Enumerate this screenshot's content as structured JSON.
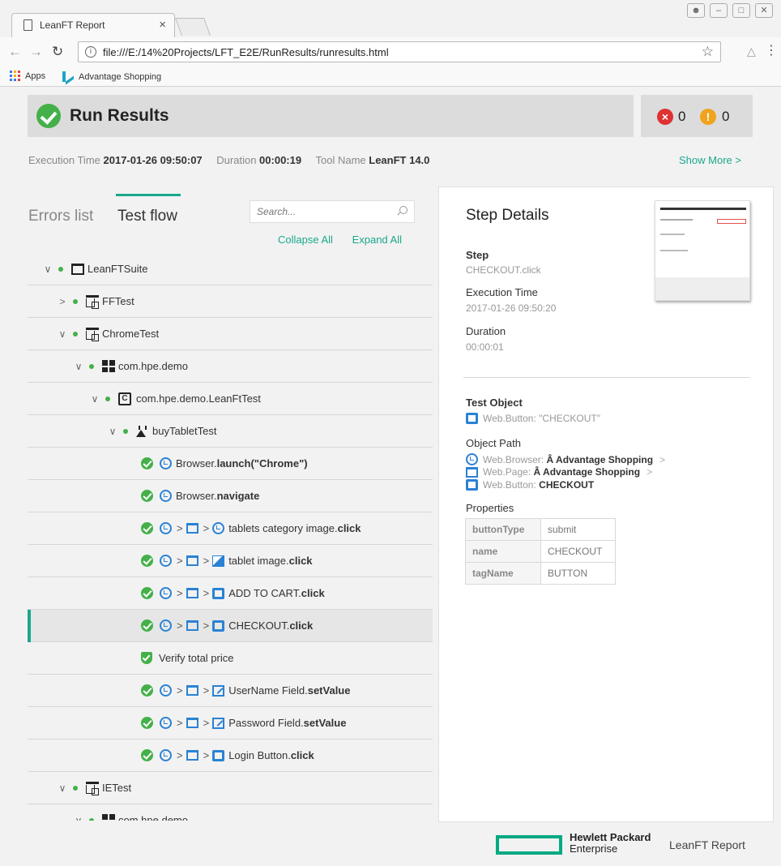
{
  "browser": {
    "tab_title": "LeanFT Report",
    "tab_close": "×",
    "url": "file:///E:/14%20Projects/LFT_E2E/RunResults/runresults.html",
    "bookmarks": [
      "Apps",
      "Advantage Shopping"
    ]
  },
  "header": {
    "title": "Run Results",
    "error_count": "0",
    "warning_count": "0"
  },
  "meta": {
    "execution_time_label": "Execution Time",
    "execution_time": "2017-01-26 09:50:07",
    "duration_label": "Duration",
    "duration": "00:00:19",
    "tool_name_label": "Tool Name",
    "tool_name": "LeanFT 14.0",
    "show_more": "Show More >"
  },
  "panel": {
    "tab_errors": "Errors list",
    "tab_flow": "Test flow",
    "search_placeholder": "Search...",
    "collapse_all": "Collapse All",
    "expand_all": "Expand All"
  },
  "tree": {
    "suite": "LeanFTSuite",
    "ff_test": "FFTest",
    "chrome_test": "ChromeTest",
    "package": "com.hpe.demo",
    "class": "com.hpe.demo.LeanFtTest",
    "method": "buyTabletTest",
    "step1": "Browser.",
    "step1_b": "launch(\"Chrome\")",
    "step2": "Browser.",
    "step2_b": "navigate",
    "step3": "tablets category image.",
    "step3_b": "click",
    "step4": "tablet image.",
    "step4_b": "click",
    "step5": "ADD TO CART.",
    "step5_b": "click",
    "step6": "CHECKOUT.",
    "step6_b": "click",
    "step7": "Verify total price",
    "step8": "UserName Field.",
    "step8_b": "setValue",
    "step9": "Password Field.",
    "step9_b": "setValue",
    "step10": "Login Button.",
    "step10_b": "click",
    "ie_test": "IETest",
    "ie_package": "com.hpe.demo"
  },
  "details": {
    "title": "Step Details",
    "step_label": "Step",
    "step_value": "CHECKOUT.click",
    "exec_label": "Execution Time",
    "exec_value": "2017-01-26 09:50:20",
    "duration_label": "Duration",
    "duration_value": "00:00:01",
    "test_object_label": "Test Object",
    "test_object_value": "Web.Button: \"CHECKOUT\"",
    "object_path_label": "Object Path",
    "path_browser_prefix": "Web.Browser:",
    "path_browser_name": "Â Advantage Shopping",
    "path_page_prefix": "Web.Page:",
    "path_page_name": "Â Advantage Shopping",
    "path_button_prefix": "Web.Button:",
    "path_button_name": "CHECKOUT",
    "path_sep": ">",
    "properties_label": "Properties",
    "properties": [
      {
        "key": "buttonType",
        "value": "submit"
      },
      {
        "key": "name",
        "value": "CHECKOUT"
      },
      {
        "key": "tagName",
        "value": "BUTTON"
      }
    ]
  },
  "footer": {
    "brand_line1": "Hewlett Packard",
    "brand_line2": "Enterprise",
    "report_name": "LeanFT Report"
  },
  "colors": {
    "accent": "#1aa88c",
    "pass": "#45b049",
    "error": "#de3232",
    "warning": "#f0a31c",
    "link_icon": "#2a82d4"
  }
}
